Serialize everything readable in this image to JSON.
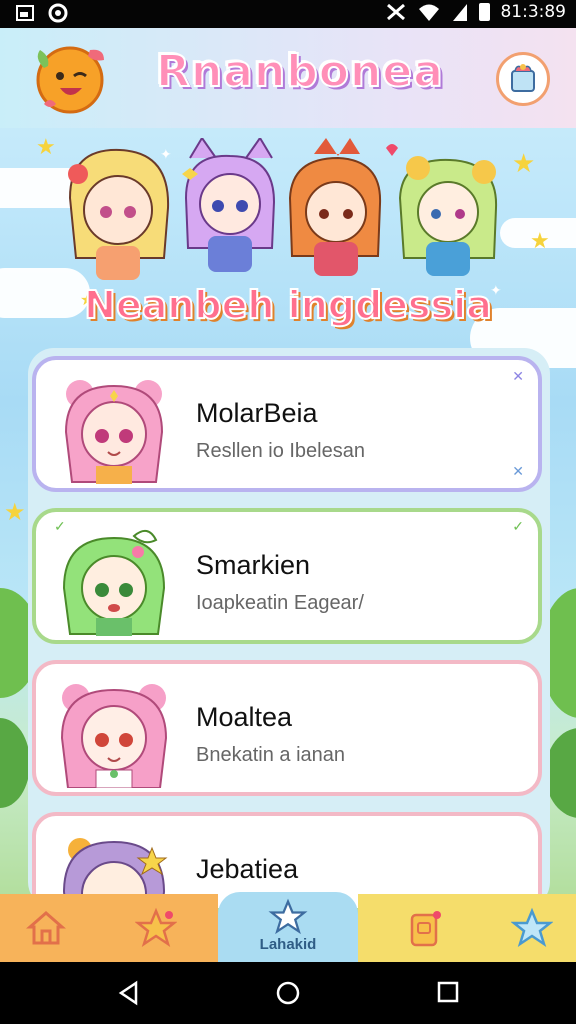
{
  "status_bar": {
    "time": "81:3:89"
  },
  "header": {
    "title": "Rnanbonea"
  },
  "banner": {
    "text": "Neanbeh ingdessia"
  },
  "characters": [
    {
      "name": "MolarBeia",
      "subtitle": "Resllen io Ibelesan",
      "hair": "#f7a3c9",
      "border": "#b9b3ef",
      "corner_top": "✕",
      "corner_bottom": "✕",
      "corner_color": "#8c84e3"
    },
    {
      "name": "Smarkien",
      "subtitle": "Ioapkeatin Eagear/",
      "hair": "#93e27a",
      "border": "#a8d98b",
      "corner_top": "✓",
      "corner_bottom": "",
      "corner_color": "#6fc054"
    },
    {
      "name": "Moaltea",
      "subtitle": "Bnekatin a ianan",
      "hair": "#f6a0c8",
      "border": "#f3b9c6",
      "corner_top": "",
      "corner_bottom": "",
      "corner_color": "#e48aa0"
    },
    {
      "name": "Jebatiea",
      "subtitle": "",
      "hair": "#b79ad8",
      "border": "#f3b9c6",
      "corner_top": "",
      "corner_bottom": "",
      "corner_color": "#e48aa0"
    }
  ],
  "tabs": [
    {
      "icon": "home-icon",
      "label": ""
    },
    {
      "icon": "star-icon",
      "label": ""
    },
    {
      "icon": "star-icon",
      "label": "Lahakid"
    },
    {
      "icon": "sticker-icon",
      "label": ""
    },
    {
      "icon": "star-icon",
      "label": ""
    }
  ],
  "colors": {
    "accent": "#aadcf2",
    "tab_bar_left": "#f7b35a",
    "tab_bar_right": "#f5dd6b"
  }
}
